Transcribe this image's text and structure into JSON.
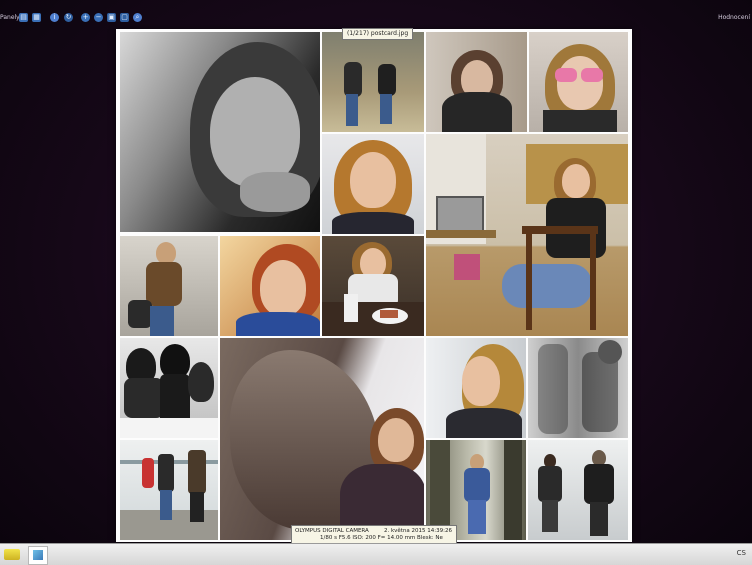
{
  "toolbar": {
    "left_label": "Panely:",
    "right_label": "Hodnocení",
    "icons": [
      "panel-icon",
      "grid-icon",
      "info-icon",
      "refresh-icon",
      "zoom-in-icon",
      "zoom-out-icon",
      "fit-icon",
      "fullscreen-icon",
      "search-icon"
    ]
  },
  "viewer": {
    "tooltip_filename": "(1/217) postcard.jpg",
    "info_camera": "OLYMPUS DIGITAL CAMERA",
    "info_date": "2. května 2015 14:39:26",
    "info_exposure": "1/80 s F5.6 ISO: 200 F= 14.00 mm Blesk: Ne"
  },
  "taskbar": {
    "clock": "CS"
  },
  "colors": {
    "viewer_bg": "#fdfdfd",
    "desktop_bg": "#1a0a1c",
    "tooltip_bg": "#f7f5e6"
  }
}
